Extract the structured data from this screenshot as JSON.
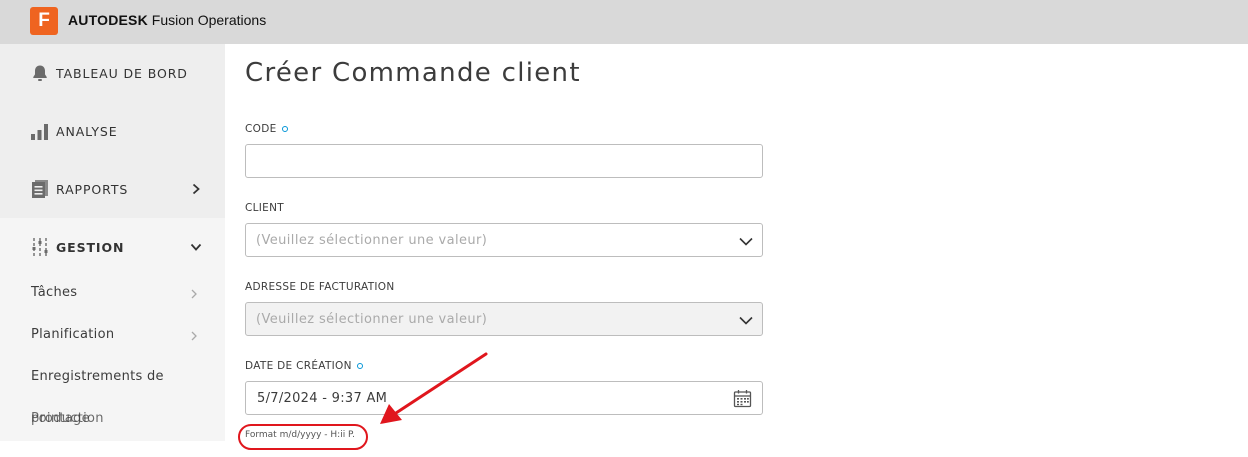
{
  "header": {
    "brand_bold": "AUTODESK",
    "brand_rest": " Fusion Operations",
    "logo_letter": "F",
    "logo_color": "#ef6420"
  },
  "sidebar": {
    "items": [
      {
        "label": "TABLEAU DE BORD",
        "icon": "bell-icon"
      },
      {
        "label": "ANALYSE",
        "icon": "bar-chart-icon"
      },
      {
        "label": "RAPPORTS",
        "icon": "reports-icon",
        "chevron": "chevron-right-icon"
      },
      {
        "label": "GESTION",
        "icon": "sliders-icon",
        "chevron": "chevron-down-icon",
        "expanded": true
      }
    ],
    "subitems": [
      {
        "label": "Tâches"
      },
      {
        "label": "Planification"
      },
      {
        "label": "Enregistrements de"
      },
      {
        "label": "Pointage",
        "overlap": "production"
      }
    ]
  },
  "main": {
    "title": "Créer Commande client",
    "fields": {
      "code": {
        "label": "CODE",
        "value": ""
      },
      "client": {
        "label": "CLIENT",
        "placeholder": "(Veuillez sélectionner une valeur)"
      },
      "billing": {
        "label": "ADRESSE DE FACTURATION",
        "placeholder": "(Veuillez sélectionner une valeur)"
      },
      "date": {
        "label": "DATE DE CRÉATION",
        "value": "5/7/2024 - 9:37 AM",
        "hint": "Format m/d/yyyy - H:ii P."
      }
    },
    "required_color": "#0696d7",
    "annotation_color": "#e0161d"
  }
}
